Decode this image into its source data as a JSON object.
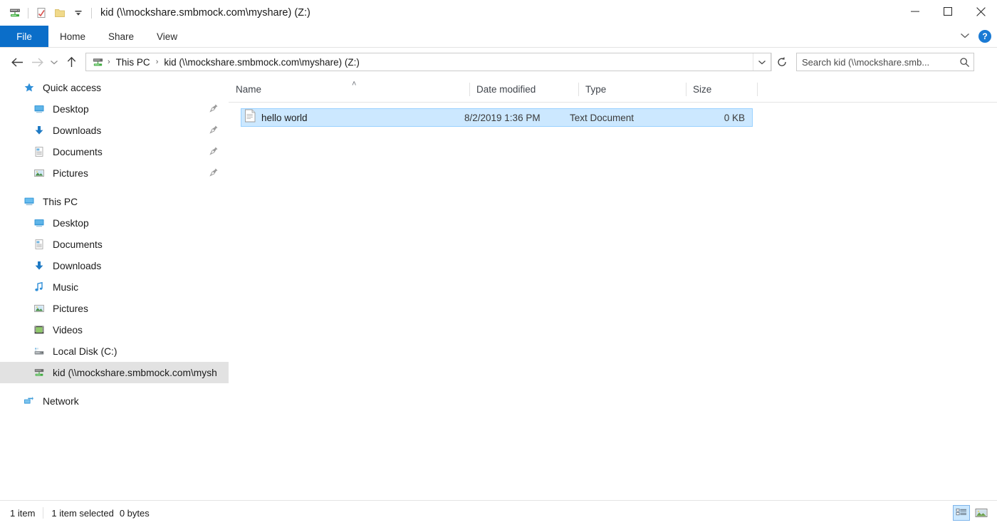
{
  "window": {
    "title": "kid (\\\\mockshare.smbmock.com\\myshare) (Z:)",
    "quick_access_toolbar": [
      {
        "name": "network-drive-icon",
        "label": "Network Drive"
      },
      {
        "name": "properties-icon",
        "label": "Properties"
      },
      {
        "name": "new-folder-icon",
        "label": "New folder"
      },
      {
        "name": "customize-quick-access-icon",
        "label": "Customize Quick Access Toolbar"
      }
    ],
    "controls": {
      "minimize": "Minimize",
      "maximize": "Maximize",
      "close": "Close"
    }
  },
  "ribbon": {
    "tabs": [
      {
        "label": "File",
        "active": true
      },
      {
        "label": "Home",
        "active": false
      },
      {
        "label": "Share",
        "active": false
      },
      {
        "label": "View",
        "active": false
      }
    ],
    "expand_label": "Expand the Ribbon",
    "help_label": "?"
  },
  "address": {
    "back_label": "Back",
    "forward_label": "Forward",
    "recent_label": "Recent locations",
    "up_label": "Up",
    "breadcrumbs": [
      {
        "label": "This PC",
        "icon": "network-drive-icon",
        "has_icon": true
      },
      {
        "label": "kid (\\\\mockshare.smbmock.com\\myshare) (Z:)",
        "has_icon": false
      }
    ],
    "separator": "›",
    "dropdown_label": "Previous locations",
    "refresh_label": "Refresh"
  },
  "search": {
    "placeholder": "Search kid (\\\\mockshare.smb...",
    "icon": "search-icon"
  },
  "sidebar": {
    "groups": [
      {
        "header": {
          "label": "Quick access",
          "icon": "star-icon"
        },
        "items": [
          {
            "label": "Desktop",
            "icon": "desktop-icon",
            "pinned": true
          },
          {
            "label": "Downloads",
            "icon": "download-icon",
            "pinned": true
          },
          {
            "label": "Documents",
            "icon": "documents-icon",
            "pinned": true
          },
          {
            "label": "Pictures",
            "icon": "pictures-icon",
            "pinned": true
          }
        ]
      },
      {
        "header": {
          "label": "This PC",
          "icon": "this-pc-icon"
        },
        "items": [
          {
            "label": "Desktop",
            "icon": "desktop-icon",
            "pinned": false
          },
          {
            "label": "Documents",
            "icon": "documents-icon",
            "pinned": false
          },
          {
            "label": "Downloads",
            "icon": "download-icon",
            "pinned": false
          },
          {
            "label": "Music",
            "icon": "music-icon",
            "pinned": false
          },
          {
            "label": "Pictures",
            "icon": "pictures-icon",
            "pinned": false
          },
          {
            "label": "Videos",
            "icon": "videos-icon",
            "pinned": false
          },
          {
            "label": "Local Disk (C:)",
            "icon": "local-disk-icon",
            "pinned": false
          },
          {
            "label": "kid (\\\\mockshare.smbmock.com\\mysh",
            "icon": "network-drive-icon",
            "pinned": false,
            "selected": true
          }
        ]
      },
      {
        "header": {
          "label": "Network",
          "icon": "network-icon"
        },
        "items": []
      }
    ]
  },
  "file_list": {
    "columns": [
      {
        "label": "Name",
        "align": "left",
        "sorted": "asc"
      },
      {
        "label": "Date modified",
        "align": "left"
      },
      {
        "label": "Type",
        "align": "left"
      },
      {
        "label": "Size",
        "align": "right"
      }
    ],
    "sort_indicator": "˄",
    "rows": [
      {
        "name": "hello world",
        "date_modified": "8/2/2019 1:36 PM",
        "type": "Text Document",
        "size": "0 KB",
        "icon": "text-document-icon",
        "selected": true
      }
    ]
  },
  "status_bar": {
    "item_count": "1 item",
    "selection": "1 item selected",
    "selection_size": "0 bytes",
    "view_buttons": [
      {
        "name": "details-view-button",
        "label": "Details view",
        "active": true
      },
      {
        "name": "large-icons-view-button",
        "label": "Large icons view",
        "active": false
      }
    ]
  },
  "colors": {
    "accent_blue": "#0b6ec9",
    "selection_fill": "#cce8ff",
    "selection_border": "#99d1ff",
    "sidebar_selected": "#e2e2e2"
  }
}
